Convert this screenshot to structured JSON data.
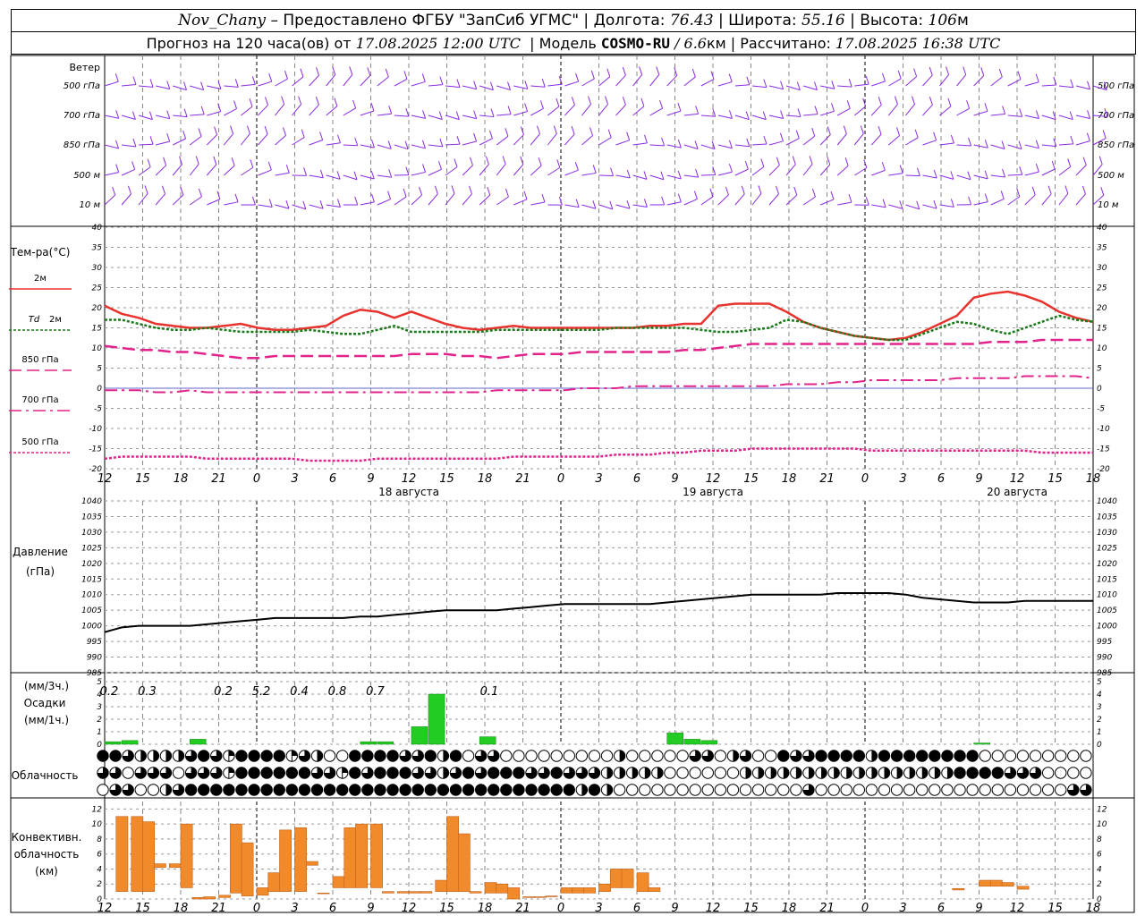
{
  "header": {
    "station": "Nov_Chany",
    "provider": "– Предоставлено ФГБУ \"ЗапСиб УГМС\"",
    "lon_label": "Долгота:",
    "lon": "76.43",
    "lat_label": "Широта:",
    "lat": "55.16",
    "alt_label": "Высота:",
    "alt": "106",
    "alt_unit": "м",
    "forecast_label": "Прогноз на 120 часа(ов) от",
    "forecast_time": "17.08.2025 12:00 UTC",
    "model_label": "Модель",
    "model": "COSMO-RU",
    "model_res": "/ 6.6",
    "model_res_unit": "км",
    "computed_label": "Рассчитано:",
    "computed_time": "17.08.2025 16:38 UTC"
  },
  "chart_data": {
    "type": "line",
    "x_ticks": [
      "12",
      "15",
      "18",
      "21",
      "0",
      "3",
      "6",
      "9",
      "12",
      "15",
      "18",
      "21",
      "0",
      "3",
      "6",
      "9",
      "12",
      "15",
      "18",
      "21",
      "0",
      "3",
      "6",
      "9",
      "12",
      "15",
      "18"
    ],
    "dates": [
      {
        "label": "18 августа",
        "tick_index": 8
      },
      {
        "label": "19 августа",
        "tick_index": 16
      },
      {
        "label": "20 августа",
        "tick_index": 24
      }
    ],
    "wind": {
      "title": "Ветер",
      "levels": [
        "500 гПа",
        "700 гПа",
        "850 гПа",
        "500 м",
        "10 м"
      ],
      "color": "#8a2be2"
    },
    "temperature": {
      "title": "Тем-ра(°C)",
      "ylim": [
        -20,
        40
      ],
      "y_ticks": [
        40,
        35,
        30,
        25,
        20,
        15,
        10,
        5,
        0,
        -5,
        -10,
        -15,
        -20
      ],
      "series": [
        {
          "name": "2м",
          "color": "#e8322d",
          "dash": "solid",
          "values": [
            20.5,
            18.5,
            17.5,
            16,
            15.5,
            15,
            15,
            15.5,
            16,
            15,
            14.5,
            14.5,
            15,
            15.5,
            18,
            19.5,
            19,
            17.5,
            19,
            17.5,
            16,
            15,
            14.5,
            15,
            15.5,
            15,
            15,
            15,
            15,
            15,
            15,
            15,
            15.5,
            15.5,
            16,
            16,
            20.5,
            21,
            21,
            21,
            19,
            16.5,
            15,
            14,
            13,
            12.5,
            12,
            12.5,
            14,
            16,
            18,
            22.5,
            23.5,
            24,
            23,
            21.5,
            19,
            17.5,
            16.5
          ]
        },
        {
          "name": "Td 2м",
          "name_italic": "Td",
          "name_suffix": "2м",
          "color": "#1a7a1a",
          "dash": "dotted",
          "values": [
            17,
            17,
            16,
            15,
            14.5,
            14.5,
            15,
            14.5,
            14,
            14,
            14,
            14,
            14.5,
            14,
            13.5,
            13.5,
            14.5,
            15.5,
            14,
            14,
            14,
            14,
            14,
            14.5,
            14.5,
            14.5,
            14.5,
            14.5,
            14.5,
            14.5,
            15,
            15,
            15,
            15,
            15,
            14.5,
            14,
            14,
            14.5,
            15,
            17,
            16.5,
            15,
            14,
            13,
            12.5,
            12,
            12,
            13.5,
            15,
            16.5,
            16,
            14.5,
            13.5,
            15,
            16.5,
            18,
            17,
            16.5
          ]
        },
        {
          "name": "850 гПа",
          "color": "#e0248c",
          "dash": "longdash",
          "values": [
            10.5,
            10,
            9.5,
            9.5,
            9,
            9,
            8.5,
            8,
            7.5,
            7.5,
            8,
            8,
            8,
            8,
            8,
            8,
            8,
            8,
            8.5,
            8.5,
            8.5,
            8,
            8,
            7.5,
            8,
            8.5,
            8.5,
            8.5,
            9,
            9,
            9,
            9,
            9,
            9,
            9.5,
            9.5,
            10,
            10.5,
            11,
            11,
            11,
            11,
            11,
            11,
            11,
            11,
            11,
            11,
            11,
            11,
            11,
            11,
            11.5,
            11.5,
            11.5,
            12,
            12,
            12,
            12
          ]
        },
        {
          "name": "700 гПа",
          "color": "#e0248c",
          "dash": "dashdot",
          "values": [
            -0.5,
            -0.5,
            -0.5,
            -1,
            -1,
            -0.5,
            -1,
            -1,
            -1,
            -1,
            -1,
            -1,
            -1,
            -1,
            -1,
            -1,
            -1,
            -1,
            -1,
            -1,
            -1,
            -1,
            -1,
            -0.5,
            -0.5,
            -0.5,
            -0.5,
            -0.5,
            0,
            0,
            0,
            0.5,
            0.5,
            0.5,
            0.5,
            0.5,
            0.5,
            0.5,
            0.5,
            0.5,
            1,
            1,
            1,
            1.5,
            1.5,
            2,
            2,
            2,
            2,
            2,
            2.5,
            2.5,
            2.5,
            2.5,
            3,
            3,
            3,
            3,
            2.5
          ]
        },
        {
          "name": "500 гПа",
          "color": "#e0248c",
          "dash": "densedot",
          "values": [
            -17.5,
            -17,
            -17,
            -17,
            -17,
            -17,
            -17.5,
            -17.5,
            -17.5,
            -17.5,
            -17.5,
            -17.5,
            -18,
            -18,
            -18,
            -18,
            -17.5,
            -17.5,
            -17.5,
            -17.5,
            -17.5,
            -17.5,
            -17.5,
            -17.5,
            -17,
            -17,
            -17,
            -17,
            -17,
            -17,
            -16.5,
            -16.5,
            -16.5,
            -16,
            -16,
            -15.5,
            -15.5,
            -15.5,
            -15,
            -15,
            -15,
            -15,
            -15,
            -15,
            -15,
            -15.5,
            -15.5,
            -15.5,
            -15.5,
            -15.5,
            -15.5,
            -15.5,
            -15.5,
            -15.5,
            -15.5,
            -16,
            -16,
            -16,
            -16
          ]
        }
      ]
    },
    "pressure": {
      "title": "Давление",
      "unit": "(гПа)",
      "ylim": [
        985,
        1040
      ],
      "y_ticks": [
        1040,
        1035,
        1030,
        1025,
        1020,
        1015,
        1010,
        1005,
        1000,
        995,
        990,
        985
      ],
      "values": [
        998,
        999.5,
        1000,
        1000,
        1000,
        1000,
        1000.5,
        1001,
        1001.5,
        1002,
        1002.5,
        1002.5,
        1002.5,
        1002.5,
        1002.5,
        1003,
        1003,
        1003.5,
        1004,
        1004.5,
        1005,
        1005,
        1005,
        1005,
        1005.5,
        1006,
        1006.5,
        1007,
        1007,
        1007,
        1007,
        1007,
        1007,
        1007.5,
        1008,
        1008.5,
        1009,
        1009.5,
        1010,
        1010,
        1010,
        1010,
        1010,
        1010.5,
        1010.5,
        1010.5,
        1010.5,
        1010,
        1009,
        1008.5,
        1008,
        1007.5,
        1007.5,
        1007.5,
        1008,
        1008,
        1008,
        1008,
        1008
      ],
      "color": "#000000"
    },
    "precipitation": {
      "label_top": "(мм/3ч.)",
      "label_mid": "Осадки",
      "label_bot": "(мм/1ч.)",
      "ylim": [
        0,
        5
      ],
      "y_ticks": [
        5,
        4,
        3,
        2,
        1,
        0
      ],
      "hourly_values": [
        0.2,
        0.3,
        0,
        0,
        0,
        0.4,
        0,
        0,
        0,
        0,
        0,
        0,
        0,
        0,
        0,
        0.2,
        0.2,
        0,
        1.4,
        4,
        0,
        0,
        0.6,
        0,
        0,
        0,
        0,
        0,
        0,
        0,
        0,
        0,
        0,
        0.9,
        0.4,
        0.3,
        0,
        0,
        0,
        0,
        0,
        0,
        0,
        0,
        0,
        0,
        0,
        0,
        0,
        0,
        0,
        0.1,
        0,
        0,
        0,
        0,
        0,
        0,
        0
      ],
      "sum_labels": [
        "0.2",
        "0.3",
        "0.2",
        "5.2",
        "0.4",
        "0.8",
        "0.7",
        "0.1"
      ],
      "sum_label_tick_pos": [
        0.5,
        1.5,
        3.5,
        4.5,
        5.5,
        6.5,
        7.5,
        10.5
      ],
      "color": "#22cc22"
    },
    "cloudiness": {
      "title": "Облачность",
      "note": "Three rows of cloud-cover octas symbols: 8=overcast, 0=clear",
      "rows": [
        [
          8,
          8,
          6,
          4,
          4,
          4,
          4,
          6,
          8,
          6,
          2,
          8,
          8,
          8,
          8,
          2,
          6,
          4,
          0,
          0,
          8,
          8,
          8,
          8,
          6,
          6,
          8,
          4,
          8,
          0,
          6,
          6,
          0,
          0,
          0,
          0,
          0,
          0,
          0,
          0,
          0,
          4,
          0,
          0,
          0,
          0,
          0,
          6,
          6,
          0,
          4,
          6,
          0,
          0,
          8,
          6,
          6,
          8,
          8,
          8,
          8,
          4,
          8,
          8,
          8,
          8,
          8,
          8,
          8,
          8,
          0,
          0,
          0,
          0,
          0,
          0,
          0,
          0,
          0
        ],
        [
          6,
          6,
          0,
          6,
          6,
          6,
          0,
          6,
          6,
          6,
          2,
          8,
          8,
          8,
          8,
          8,
          8,
          6,
          6,
          2,
          8,
          6,
          8,
          8,
          8,
          6,
          6,
          4,
          6,
          8,
          6,
          8,
          8,
          8,
          6,
          6,
          8,
          6,
          6,
          6,
          4,
          4,
          4,
          4,
          4,
          0,
          0,
          0,
          0,
          0,
          0,
          4,
          4,
          4,
          4,
          4,
          4,
          4,
          4,
          4,
          4,
          4,
          4,
          4,
          4,
          4,
          4,
          4,
          8,
          8,
          8,
          8,
          6,
          6,
          6,
          0,
          0,
          0,
          0
        ],
        [
          0,
          6,
          6,
          0,
          0,
          4,
          6,
          8,
          8,
          8,
          8,
          8,
          8,
          8,
          8,
          8,
          8,
          8,
          8,
          8,
          8,
          8,
          8,
          8,
          8,
          8,
          8,
          8,
          8,
          8,
          8,
          8,
          8,
          8,
          8,
          8,
          8,
          8,
          4,
          8,
          4,
          0,
          0,
          0,
          0,
          0,
          0,
          0,
          0,
          0,
          0,
          0,
          0,
          0,
          0,
          0,
          6,
          0,
          0,
          0,
          0,
          0,
          0,
          0,
          0,
          0,
          0,
          0,
          0,
          0,
          0,
          0,
          0,
          0,
          0,
          0,
          0,
          6,
          6
        ]
      ]
    },
    "convective": {
      "title_1": "Конвективн.",
      "title_2": "облачность",
      "title_3": "(км)",
      "ylim": [
        0,
        13
      ],
      "y_ticks": [
        12,
        10,
        8,
        6,
        4,
        2,
        0
      ],
      "color": "#f08a2a",
      "bars": [
        [
          1,
          11,
          0
        ],
        [
          1,
          11,
          0
        ],
        [
          1,
          10.3,
          0
        ],
        [
          4.2,
          4.7,
          0
        ],
        [
          4.2,
          4.7,
          0
        ],
        [
          1.5,
          10,
          0
        ],
        [
          0,
          0.2,
          0
        ],
        [
          0,
          0.3,
          0
        ],
        [
          0.2,
          0.5,
          0
        ],
        [
          0.8,
          10,
          0
        ],
        [
          0.4,
          7.5,
          0
        ],
        [
          0.5,
          1.5,
          0
        ],
        [
          1,
          3.5,
          0
        ],
        [
          1,
          9.2,
          0
        ],
        [
          1,
          9.5,
          0
        ],
        [
          4.5,
          5,
          0
        ],
        [
          0.7,
          0.8,
          0
        ],
        [
          1.5,
          3,
          0
        ],
        [
          1.5,
          9.5,
          0
        ],
        [
          1.5,
          10,
          0
        ],
        [
          1.5,
          10,
          0
        ],
        [
          0.8,
          1,
          0
        ],
        [
          0.8,
          1,
          0
        ],
        [
          0.8,
          1,
          0
        ],
        [
          0.8,
          1,
          0
        ],
        [
          1,
          2.5,
          0
        ],
        [
          1,
          11,
          0
        ],
        [
          1,
          8.7,
          0
        ],
        [
          0.8,
          1,
          0
        ],
        [
          0.8,
          2.2,
          0
        ],
        [
          0.8,
          2,
          0
        ],
        [
          0,
          1.5,
          0
        ],
        [
          0.2,
          0.3,
          0
        ],
        [
          0.2,
          0.3,
          0
        ],
        [
          0.3,
          0.4,
          0
        ],
        [
          0.8,
          1.5,
          0
        ],
        [
          0.8,
          1.5,
          0
        ],
        [
          0.8,
          1.5,
          0
        ],
        [
          1,
          2,
          0
        ],
        [
          1.5,
          4,
          0
        ],
        [
          1.5,
          4,
          0
        ],
        [
          1,
          3.5,
          0
        ],
        [
          1,
          1.5,
          0
        ],
        [
          1.2,
          1.4,
          0
        ],
        [
          1.7,
          2.5,
          0
        ],
        [
          1.7,
          2.5,
          0
        ],
        [
          1.7,
          2.2,
          0
        ],
        [
          1.3,
          1.7,
          0
        ]
      ],
      "bar_positions": [
        0.3,
        0.7,
        1.0,
        1.3,
        1.7,
        2.0,
        2.3,
        2.6,
        3.0,
        3.3,
        3.6,
        4.0,
        4.3,
        4.6,
        5.0,
        5.3,
        5.6,
        6.0,
        6.3,
        6.6,
        7.0,
        7.3,
        7.7,
        8.0,
        8.3,
        8.7,
        9.0,
        9.3,
        9.6,
        10.0,
        10.3,
        10.6,
        11.0,
        11.3,
        11.6,
        12.0,
        12.3,
        12.6,
        13.0,
        13.3,
        13.6,
        14.0,
        14.3,
        22.3,
        23.0,
        23.3,
        23.6,
        24.0
      ]
    }
  }
}
